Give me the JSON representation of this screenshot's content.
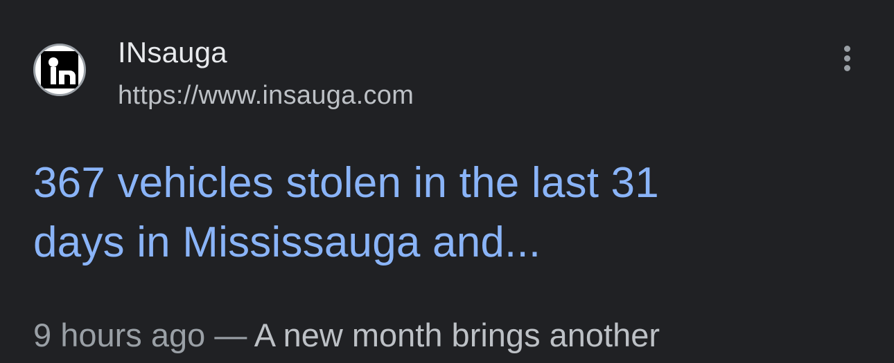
{
  "result": {
    "site_name": "INsauga",
    "site_url": "https://www.insauga.com",
    "favicon": "insauga-logo-icon",
    "more_options_icon": "more-vertical-icon",
    "title_line1": "367 vehicles stolen in the last 31",
    "title_line2": "days in Mississauga and...",
    "time_ago": "9 hours ago",
    "separator": "—",
    "snippet": "A new month brings another"
  },
  "colors": {
    "background": "#202124",
    "title_link": "#8ab4f8",
    "site_name": "#e8eaed",
    "secondary_text": "#bdc1c6"
  }
}
